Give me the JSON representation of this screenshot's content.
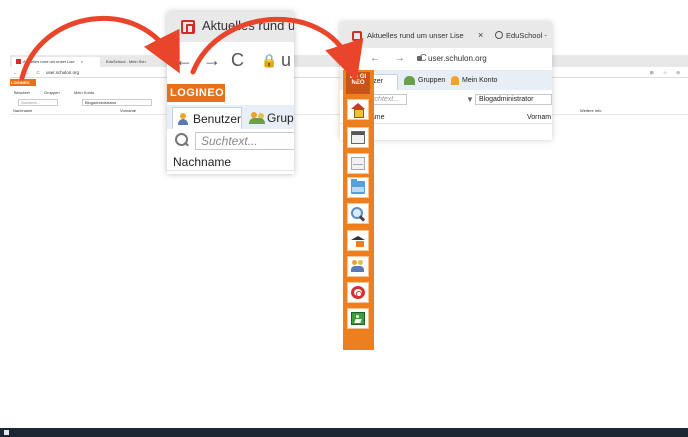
{
  "colors": {
    "accent_orange": "#ee7f1c",
    "logo_orange": "#e8701a",
    "arrow_red": "#e8452a",
    "taskbar": "#1c2733"
  },
  "background_screenshot": {
    "tab1_title": "Aktuelles rund um unser Lise",
    "tab1_close": "×",
    "tab2_title": "EduSchool - Mein Sch",
    "nav_buttons": "← → C",
    "url": "user.schulon.org",
    "right_icons": "⊞ ☆ ⊖",
    "logo": "LOGINEO",
    "tabs": [
      "Benutzer",
      "Gruppen",
      "Mein Konto"
    ],
    "search_placeholder": "Suchtext...",
    "group_filter": "Blogadministrator",
    "column_headers": [
      "Nachname",
      "Vorname",
      "Weitere Info"
    ]
  },
  "zoom_panel_1": {
    "tab_title": "Aktuelles rund um u",
    "back_icon": "←",
    "forward_icon": "→",
    "reload_icon": "C",
    "lock_icon": "🔒",
    "url_partial": "u",
    "logo": "LOGINEO",
    "tab_users": "Benutzer",
    "tab_groups": "Grupp",
    "search_placeholder": "Suchtext...",
    "column_header": "Nachname"
  },
  "zoom_panel_2": {
    "tab_title": "Aktuelles rund um unser Lise",
    "tab_close": "×",
    "tab2_title": "EduSchool -",
    "nav_buttons": "← → C",
    "url": "user.schulon.org",
    "tabs": [
      "Benutzer",
      "Gruppen",
      "Mein Konto"
    ],
    "search_placeholder": "Suchtext...",
    "filter_icon": "▼",
    "group_filter": "Blogadministrator",
    "column_headers": [
      "name",
      "Vornam"
    ]
  },
  "sidebar": {
    "logo_text": "LO GI NEO",
    "items": [
      {
        "icon": "home-icon"
      },
      {
        "icon": "window-icon"
      },
      {
        "icon": "mail-icon"
      },
      {
        "icon": "folder-icon"
      },
      {
        "icon": "search-icon"
      },
      {
        "icon": "learning-icon"
      },
      {
        "icon": "users-icon"
      },
      {
        "icon": "help-icon"
      },
      {
        "icon": "exit-icon"
      }
    ]
  }
}
